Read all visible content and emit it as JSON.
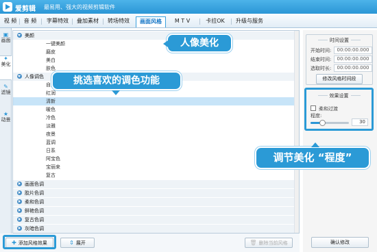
{
  "title_bar": {
    "app_name": "爱剪辑",
    "slogan": "最易用、强大的视频剪辑软件"
  },
  "menu": [
    {
      "label": "视 频",
      "active": false
    },
    {
      "label": "音 频",
      "active": false
    },
    {
      "label": "字幕特效",
      "active": false
    },
    {
      "label": "叠加素材",
      "active": false
    },
    {
      "label": "转场特效",
      "active": false
    },
    {
      "label": "画面风格",
      "active": true
    },
    {
      "label": "M T V",
      "active": false
    },
    {
      "label": "卡拉OK",
      "active": false
    },
    {
      "label": "升级与服务",
      "active": false
    }
  ],
  "side_tabs": [
    {
      "label": "画面",
      "icon": "picture-icon"
    },
    {
      "label": "美化",
      "icon": "magic-wand-icon"
    },
    {
      "label": "滤镜",
      "icon": "brush-icon"
    },
    {
      "label": "动景",
      "icon": "star-icon"
    }
  ],
  "style_list": [
    {
      "label": "美颜",
      "type": "category",
      "expanded": true
    },
    {
      "label": "一键美颜",
      "type": "item"
    },
    {
      "label": "磨皮",
      "type": "item"
    },
    {
      "label": "美白",
      "type": "item"
    },
    {
      "label": "肤色",
      "type": "item"
    },
    {
      "label": "人像调色",
      "type": "category",
      "expanded": true
    },
    {
      "label": "自然",
      "type": "item"
    },
    {
      "label": "红润",
      "type": "item"
    },
    {
      "label": "清新",
      "type": "item",
      "selected": true
    },
    {
      "label": "暖色",
      "type": "item"
    },
    {
      "label": "冷色",
      "type": "item"
    },
    {
      "label": "淡雅",
      "type": "item"
    },
    {
      "label": "夜景",
      "type": "item"
    },
    {
      "label": "蓝调",
      "type": "item"
    },
    {
      "label": "日系",
      "type": "item"
    },
    {
      "label": "阿宝色",
      "type": "item"
    },
    {
      "label": "宝丽来",
      "type": "item"
    },
    {
      "label": "复古",
      "type": "item"
    },
    {
      "label": "画面色调",
      "type": "category",
      "expanded": false
    },
    {
      "label": "胶片色调",
      "type": "category",
      "expanded": false
    },
    {
      "label": "柔和色调",
      "type": "category",
      "expanded": false
    },
    {
      "label": "鲜艳色调",
      "type": "category",
      "expanded": false
    },
    {
      "label": "复古色调",
      "type": "category",
      "expanded": false
    },
    {
      "label": "灰暗色调",
      "type": "category",
      "expanded": false
    }
  ],
  "bottom_buttons": {
    "add": "添加风格效果",
    "expand": "展开",
    "delete": "删除当前风格"
  },
  "callouts": {
    "beautify": "人像美化",
    "pick_color": "挑选喜欢的调色功能",
    "adjust": "调节美化 “程度”"
  },
  "time_settings": {
    "title": "时间设置",
    "start_label": "开始时间:",
    "start_value": "00:00:00.000",
    "end_label": "结束时间:",
    "end_value": "00:00:00.000",
    "duration_label": "选取时长:",
    "duration_value": "00:00:00.000",
    "modify_button": "修改风格时间段"
  },
  "effect_settings": {
    "title": "效果设置",
    "soft_transition_label": "柔和过渡",
    "soft_transition_checked": false,
    "degree_label": "程度:",
    "degree_value": "30",
    "degree_fraction": 0.3
  },
  "confirm_button": "确认修改",
  "colors": {
    "accent": "#2b9ad6",
    "selected_row": "#c7e4f8"
  }
}
